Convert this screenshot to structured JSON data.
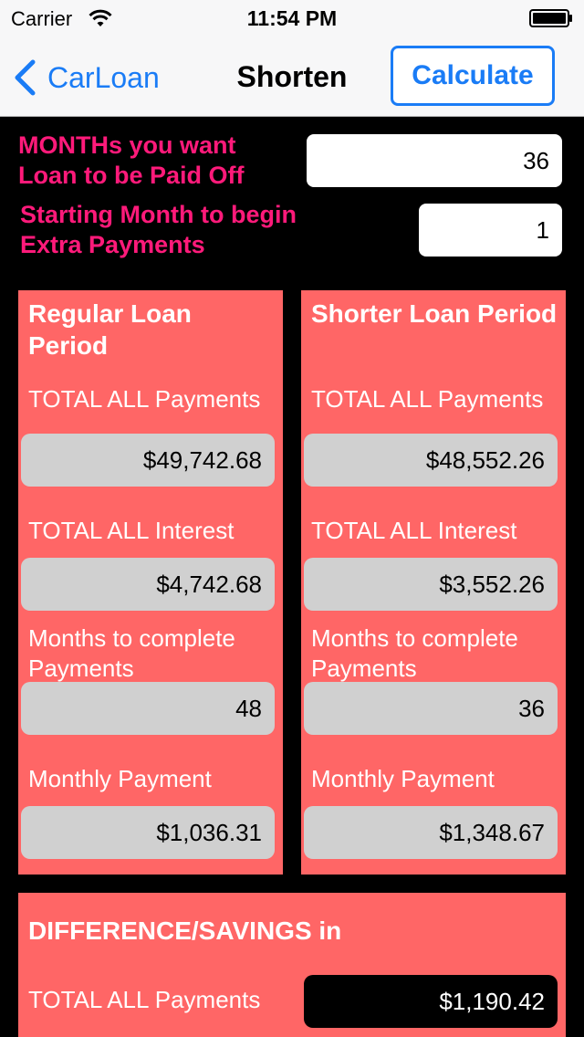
{
  "status_bar": {
    "carrier": "Carrier",
    "time": "11:54 PM",
    "wifi_icon": "wifi-icon",
    "battery_icon": "battery-full-icon"
  },
  "nav": {
    "back_label": "CarLoan",
    "back_icon": "chevron-left-icon",
    "title": "Shorten",
    "calculate_label": "Calculate",
    "accent_color": "#1a7cf6"
  },
  "inputs": {
    "months_label": "MONTHs you want Loan to be Paid Off",
    "months_value": "36",
    "start_label": "Starting Month to begin Extra Payments",
    "start_value": "1",
    "label_color": "#ff1a7a"
  },
  "regular": {
    "title": "Regular Loan Period",
    "total_payments_label": "TOTAL ALL Payments",
    "total_payments": "$49,742.68",
    "total_interest_label": "TOTAL ALL Interest",
    "total_interest": "$4,742.68",
    "months_label": "Months to complete Payments",
    "months": "48",
    "monthly_label": "Monthly Payment",
    "monthly": "$1,036.31"
  },
  "shorter": {
    "title": "Shorter Loan Period",
    "total_payments_label": "TOTAL ALL Payments",
    "total_payments": "$48,552.26",
    "total_interest_label": "TOTAL ALL Interest",
    "total_interest": "$3,552.26",
    "months_label": "Months to complete Payments",
    "months": "36",
    "monthly_label": "Monthly Payment",
    "monthly": "$1,348.67"
  },
  "difference": {
    "title": "DIFFERENCE/SAVINGS in",
    "total_payments_label": "TOTAL ALL Payments",
    "total_payments": "$1,190.42"
  },
  "colors": {
    "panel": "#ff6666",
    "value_box": "#d0d0d0",
    "background": "#000000"
  }
}
